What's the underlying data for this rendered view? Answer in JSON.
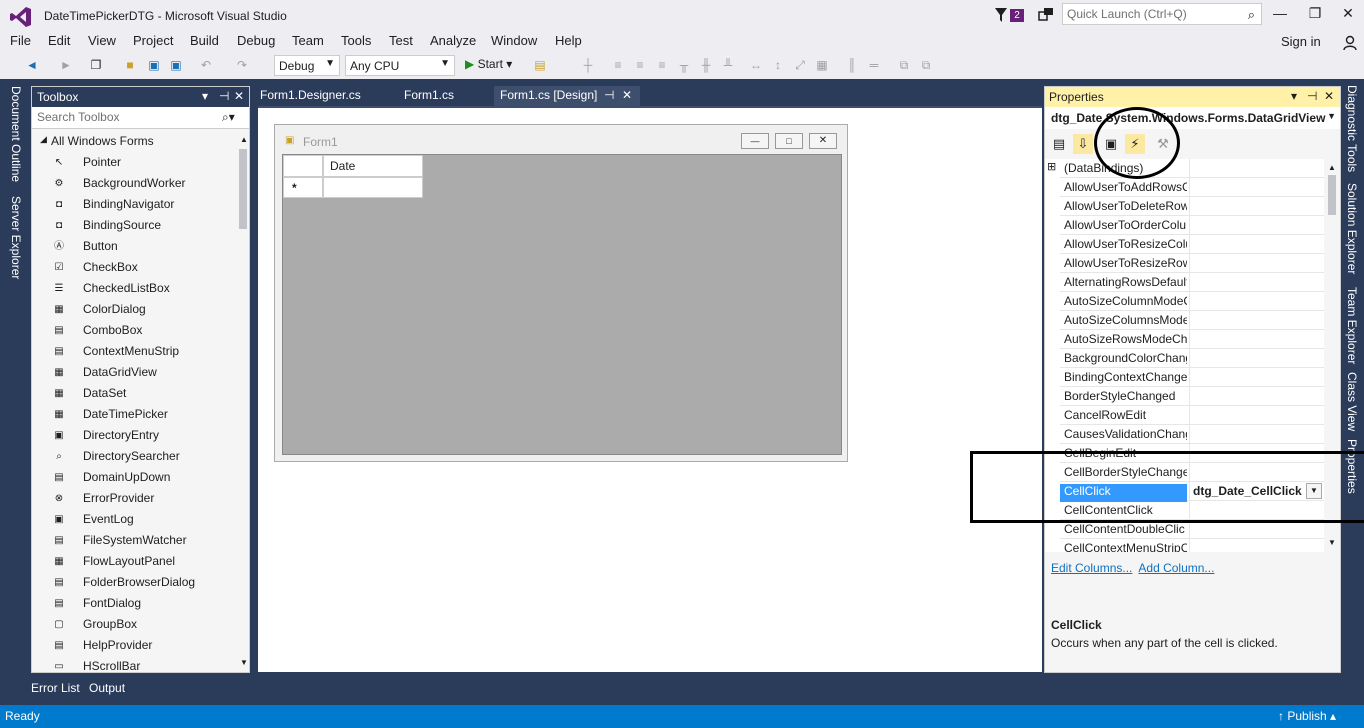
{
  "window": {
    "title": "DateTimePickerDTG - Microsoft Visual Studio",
    "notification_count": "2",
    "quick_launch_placeholder": "Quick Launch (Ctrl+Q)",
    "sign_in": "Sign in"
  },
  "menu": [
    "File",
    "Edit",
    "View",
    "Project",
    "Build",
    "Debug",
    "Team",
    "Tools",
    "Test",
    "Analyze",
    "Window",
    "Help"
  ],
  "toolbar": {
    "config": "Debug",
    "platform": "Any CPU",
    "start": "Start"
  },
  "left_tabs": [
    "Document Outline",
    "Server Explorer"
  ],
  "toolbox": {
    "title": "Toolbox",
    "search_placeholder": "Search Toolbox",
    "group": "All Windows Forms",
    "items": [
      "Pointer",
      "BackgroundWorker",
      "BindingNavigator",
      "BindingSource",
      "Button",
      "CheckBox",
      "CheckedListBox",
      "ColorDialog",
      "ComboBox",
      "ContextMenuStrip",
      "DataGridView",
      "DataSet",
      "DateTimePicker",
      "DirectoryEntry",
      "DirectorySearcher",
      "DomainUpDown",
      "ErrorProvider",
      "EventLog",
      "FileSystemWatcher",
      "FlowLayoutPanel",
      "FolderBrowserDialog",
      "FontDialog",
      "GroupBox",
      "HelpProvider",
      "HScrollBar"
    ]
  },
  "doc_tabs": [
    "Form1.Designer.cs",
    "Form1.cs",
    "Form1.cs [Design]"
  ],
  "designer": {
    "form_title": "Form1",
    "grid_column": "Date",
    "new_row_marker": "*"
  },
  "properties": {
    "title": "Properties",
    "object": "dtg_Date System.Windows.Forms.DataGridView",
    "rows": [
      {
        "name": "(DataBindings)",
        "value": ""
      },
      {
        "name": "AllowUserToAddRowsC",
        "value": ""
      },
      {
        "name": "AllowUserToDeleteRow",
        "value": ""
      },
      {
        "name": "AllowUserToOrderColu",
        "value": ""
      },
      {
        "name": "AllowUserToResizeColu",
        "value": ""
      },
      {
        "name": "AllowUserToResizeRows",
        "value": ""
      },
      {
        "name": "AlternatingRowsDefault",
        "value": ""
      },
      {
        "name": "AutoSizeColumnModeC",
        "value": ""
      },
      {
        "name": "AutoSizeColumnsMode",
        "value": ""
      },
      {
        "name": "AutoSizeRowsModeCha",
        "value": ""
      },
      {
        "name": "BackgroundColorChang",
        "value": ""
      },
      {
        "name": "BindingContextChange",
        "value": ""
      },
      {
        "name": "BorderStyleChanged",
        "value": ""
      },
      {
        "name": "CancelRowEdit",
        "value": ""
      },
      {
        "name": "CausesValidationChang",
        "value": ""
      },
      {
        "name": "CellBeginEdit",
        "value": ""
      },
      {
        "name": "CellBorderStyleChangec",
        "value": ""
      },
      {
        "name": "CellClick",
        "value": "dtg_Date_CellClick"
      },
      {
        "name": "CellContentClick",
        "value": ""
      },
      {
        "name": "CellContentDoubleClic",
        "value": ""
      },
      {
        "name": "CellContextMenuStripC",
        "value": ""
      }
    ],
    "links": [
      "Edit Columns...",
      "Add Column..."
    ],
    "desc_title": "CellClick",
    "desc_text": "Occurs when any part of the cell is clicked."
  },
  "right_tabs": [
    "Diagnostic Tools",
    "Solution Explorer",
    "Team Explorer",
    "Class View",
    "Properties"
  ],
  "bottom_tabs": [
    "Error List",
    "Output"
  ],
  "status": {
    "text": "Ready",
    "publish": "Publish"
  }
}
